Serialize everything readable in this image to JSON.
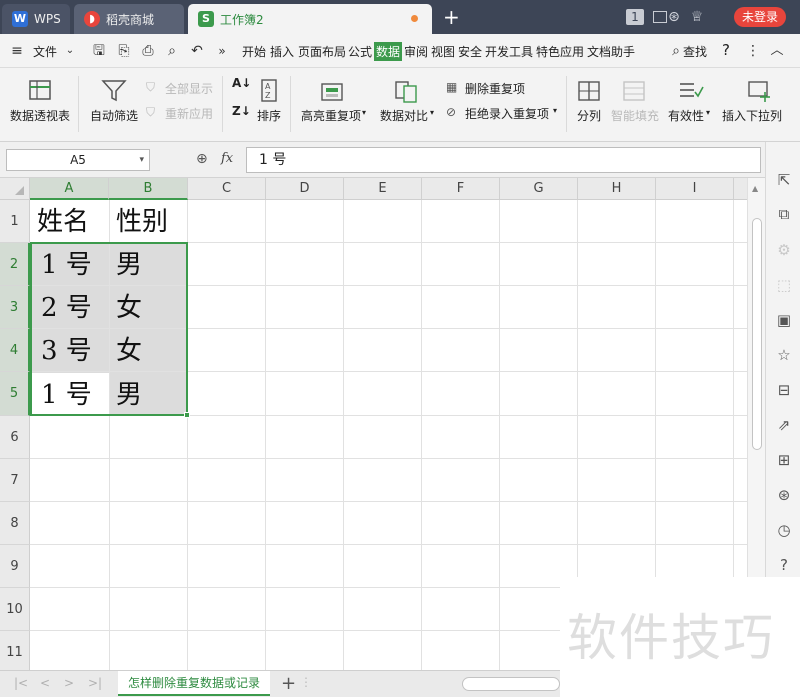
{
  "titlebar": {
    "tabs": [
      {
        "label": "WPS",
        "icon": "wps-logo-icon"
      },
      {
        "label": "稻壳商城",
        "icon": "docer-icon"
      },
      {
        "label": "工作簿2",
        "icon": "spreadsheet-icon"
      }
    ],
    "new_tab": "+",
    "badge": "1",
    "login": "未登录"
  },
  "menu": {
    "file": "文件",
    "items": [
      "开始",
      "插入",
      "页面布局",
      "公式",
      "数据",
      "审阅",
      "视图",
      "安全",
      "开发工具",
      "特色应用",
      "文档助手"
    ],
    "active": "数据",
    "search": "查找",
    "help": "?",
    "collapse": "^"
  },
  "ribbon": {
    "pivot": "数据透视表",
    "autofilter": "自动筛选",
    "show_all": "全部显示",
    "reapply": "重新应用",
    "sort": "排序",
    "highlight_dup": "高亮重复项",
    "data_compare": "数据对比",
    "remove_dup": "删除重复项",
    "reject_dup": "拒绝录入重复项",
    "split": "分列",
    "smart_fill": "智能填充",
    "validity": "有效性",
    "insert_dropdown": "插入下拉列"
  },
  "formula": {
    "name_box": "A5",
    "fx": "fx",
    "value": "1 号"
  },
  "grid": {
    "columns": [
      "A",
      "B",
      "C",
      "D",
      "E",
      "F",
      "G",
      "H",
      "I"
    ],
    "rows": [
      "1",
      "2",
      "3",
      "4",
      "5",
      "6",
      "7",
      "8",
      "9",
      "10",
      "11"
    ],
    "cells": [
      [
        "姓名",
        "性别"
      ],
      [
        "1 号",
        "男"
      ],
      [
        "2 号",
        "女"
      ],
      [
        "3 号",
        "女"
      ],
      [
        "1 号",
        "男"
      ]
    ]
  },
  "sheets": {
    "active": "怎样删除重复数据或记录",
    "add": "+"
  },
  "watermark": "软件技巧",
  "colors": {
    "accent": "#3c9a4c",
    "titlebar": "#3d4556",
    "login": "#e8453c"
  }
}
